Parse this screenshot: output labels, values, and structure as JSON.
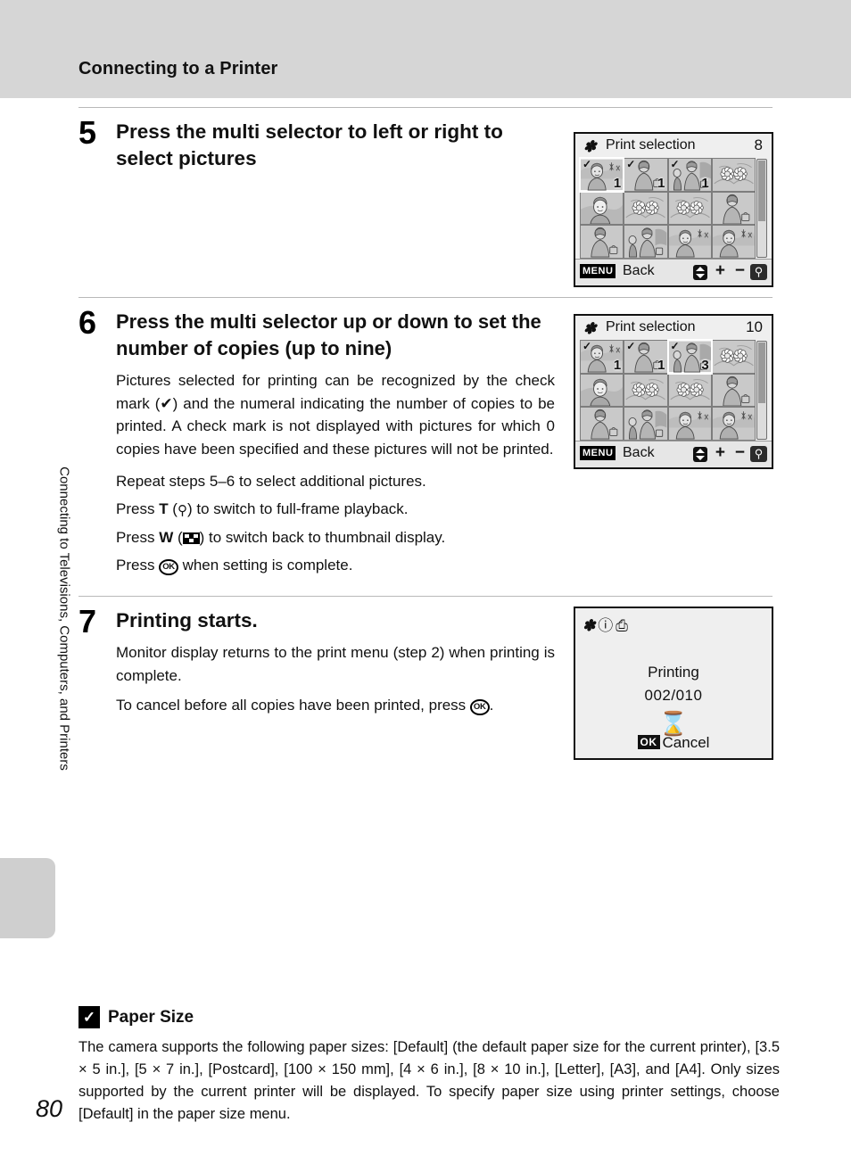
{
  "header": {
    "title": "Connecting to a Printer"
  },
  "sidebar": {
    "chapter_text": "Connecting to Televisions, Computers, and Printers",
    "page_number": "80"
  },
  "steps": [
    {
      "number": "5",
      "heading": "Press the multi selector to left or right to select pictures"
    },
    {
      "number": "6",
      "heading": "Press the multi selector up or down to set the number of copies (up to nine)",
      "paragraph": "Pictures selected for printing can be recognized by the check mark (✔) and the numeral indicating the number of copies to be printed. A check mark is not displayed with pictures for which 0 copies have been specified and these pictures will not be printed.",
      "lines": [
        "Repeat steps 5–6 to select additional pictures.",
        "Press T (⌕) to switch to full-frame playback.",
        "Press W (▦) to switch back to thumbnail display.",
        "Press ⒪ when setting is complete."
      ],
      "line_parts": {
        "repeat": "Repeat steps 5–6 to select additional pictures.",
        "press_t_pre": "Press ",
        "press_t_key": "T",
        "press_t_mid": " (",
        "press_t_icon": "zoom-in-icon",
        "press_t_post": ") to switch to full-frame playback.",
        "press_w_pre": "Press ",
        "press_w_key": "W",
        "press_w_mid": " (",
        "press_w_icon": "thumbnail-icon",
        "press_w_post": ") to switch back to thumbnail display.",
        "press_ok_pre": "Press ",
        "press_ok_key": "OK",
        "press_ok_post": " when setting is complete."
      }
    },
    {
      "number": "7",
      "heading": "Printing starts.",
      "paragraph1": "Monitor display returns to the print menu (step 2) when printing is complete.",
      "paragraph2_pre": "To cancel before all copies have been printed, press ",
      "paragraph2_key": "OK",
      "paragraph2_post": "."
    }
  ],
  "screens": [
    {
      "id": "print-selection-8",
      "title": "Print selection",
      "count": "8",
      "title_icon": "pictbridge-icon",
      "thumbnails": [
        {
          "checked": true,
          "copies": "1",
          "selected": true,
          "subject": "woman-outdoors"
        },
        {
          "checked": true,
          "copies": "1",
          "selected": false,
          "subject": "woman-with-bag"
        },
        {
          "checked": true,
          "copies": "1",
          "selected": false,
          "subject": "woman-and-child"
        },
        {
          "checked": false,
          "copies": "",
          "selected": false,
          "subject": "flowers"
        },
        {
          "checked": false,
          "copies": "",
          "selected": false,
          "subject": "portrait"
        },
        {
          "checked": false,
          "copies": "",
          "selected": false,
          "subject": "flowers"
        },
        {
          "checked": false,
          "copies": "",
          "selected": false,
          "subject": "flowers"
        },
        {
          "checked": false,
          "copies": "",
          "selected": false,
          "subject": "woman-with-bag"
        },
        {
          "checked": false,
          "copies": "",
          "selected": false,
          "subject": "woman-with-bag"
        },
        {
          "checked": false,
          "copies": "",
          "selected": false,
          "subject": "woman-and-child"
        },
        {
          "checked": false,
          "copies": "",
          "selected": false,
          "subject": "woman-outdoors"
        },
        {
          "checked": false,
          "copies": "",
          "selected": false,
          "subject": "woman-outdoors"
        }
      ],
      "bottom": {
        "menu_badge": "MENU",
        "back_label": "Back",
        "updown_icon": "up-down-arrow-icon",
        "plus": "+",
        "minus": "−",
        "magnifier_icon": "magnifier-icon"
      }
    },
    {
      "id": "print-selection-10",
      "title": "Print selection",
      "count": "10",
      "title_icon": "pictbridge-icon",
      "thumbnails": [
        {
          "checked": true,
          "copies": "1",
          "selected": false,
          "subject": "woman-outdoors"
        },
        {
          "checked": true,
          "copies": "1",
          "selected": false,
          "subject": "woman-with-bag"
        },
        {
          "checked": true,
          "copies": "3",
          "selected": true,
          "subject": "woman-and-child"
        },
        {
          "checked": false,
          "copies": "",
          "selected": false,
          "subject": "flowers"
        },
        {
          "checked": false,
          "copies": "",
          "selected": false,
          "subject": "portrait"
        },
        {
          "checked": false,
          "copies": "",
          "selected": false,
          "subject": "flowers"
        },
        {
          "checked": false,
          "copies": "",
          "selected": false,
          "subject": "flowers"
        },
        {
          "checked": false,
          "copies": "",
          "selected": false,
          "subject": "woman-with-bag"
        },
        {
          "checked": false,
          "copies": "",
          "selected": false,
          "subject": "woman-with-bag"
        },
        {
          "checked": false,
          "copies": "",
          "selected": false,
          "subject": "woman-and-child"
        },
        {
          "checked": false,
          "copies": "",
          "selected": false,
          "subject": "woman-outdoors"
        },
        {
          "checked": false,
          "copies": "",
          "selected": false,
          "subject": "woman-outdoors"
        }
      ],
      "bottom": {
        "menu_badge": "MENU",
        "back_label": "Back",
        "updown_icon": "up-down-arrow-icon",
        "plus": "+",
        "minus": "−",
        "magnifier_icon": "magnifier-icon"
      }
    }
  ],
  "printing_screen": {
    "id": "printing-progress",
    "status_icons": [
      "pictbridge-icon",
      "warning-icon",
      "printer-icon"
    ],
    "icons_glyphs": "❕ ⓘ ⎙",
    "label": "Printing",
    "progress": "002/010",
    "busy_icon": "hourglass-icon",
    "cancel_key": "OK",
    "cancel_label": "Cancel"
  },
  "note": {
    "icon": "checkmark-note-icon",
    "title": "Paper Size",
    "body": "The camera supports the following paper sizes: [Default] (the default paper size for the current printer), [3.5 × 5 in.], [5 × 7 in.], [Postcard], [100 × 150 mm], [4 × 6 in.], [8 × 10 in.], [Letter], [A3], and [A4]. Only sizes supported by the current printer will be displayed. To specify paper size using printer settings, choose [Default] in the paper size menu."
  }
}
